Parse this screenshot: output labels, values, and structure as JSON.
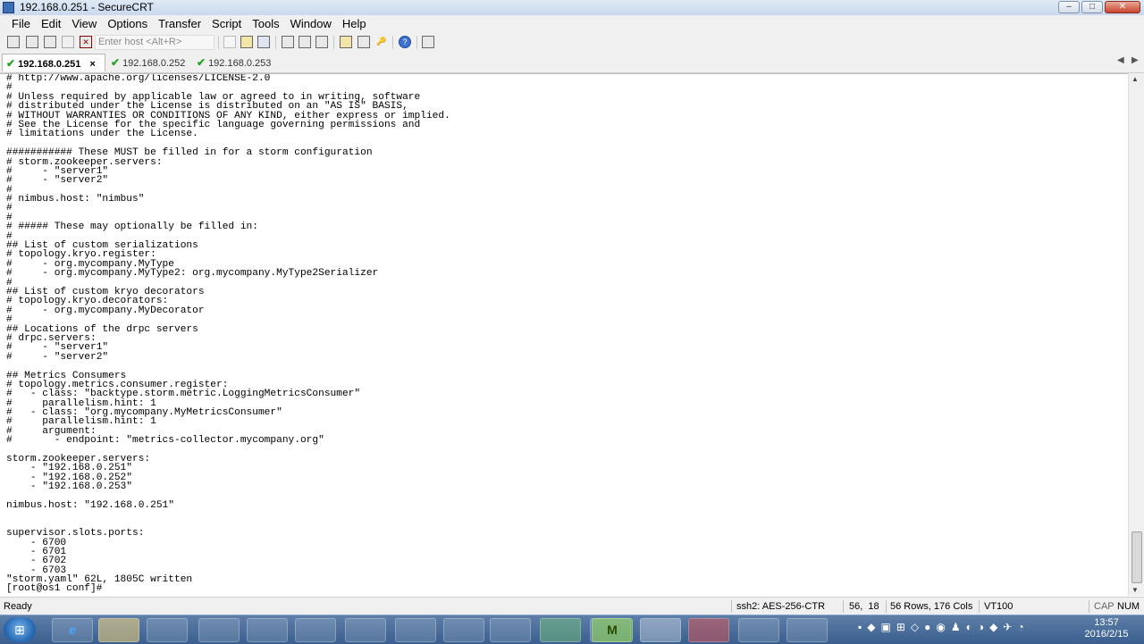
{
  "window": {
    "title": "192.168.0.251 - SecureCRT",
    "buttons": {
      "minimize": "–",
      "maximize": "□",
      "close": "✕"
    }
  },
  "menu": [
    "File",
    "Edit",
    "View",
    "Options",
    "Transfer",
    "Script",
    "Tools",
    "Window",
    "Help"
  ],
  "toolbar": {
    "host_placeholder": "Enter host <Alt+R>"
  },
  "tabs": [
    {
      "label": "192.168.0.251",
      "active": true,
      "close": "×"
    },
    {
      "label": "192.168.0.252",
      "active": false
    },
    {
      "label": "192.168.0.253",
      "active": false
    }
  ],
  "tab_nav": {
    "prev": "◀",
    "next": "▶"
  },
  "terminal": {
    "lines": [
      "# http://www.apache.org/licenses/LICENSE-2.0",
      "#",
      "# Unless required by applicable law or agreed to in writing, software",
      "# distributed under the License is distributed on an \"AS IS\" BASIS,",
      "# WITHOUT WARRANTIES OR CONDITIONS OF ANY KIND, either express or implied.",
      "# See the License for the specific language governing permissions and",
      "# limitations under the License.",
      "",
      "########### These MUST be filled in for a storm configuration",
      "# storm.zookeeper.servers:",
      "#     - \"server1\"",
      "#     - \"server2\"",
      "#",
      "# nimbus.host: \"nimbus\"",
      "#",
      "#",
      "# ##### These may optionally be filled in:",
      "#",
      "## List of custom serializations",
      "# topology.kryo.register:",
      "#     - org.mycompany.MyType",
      "#     - org.mycompany.MyType2: org.mycompany.MyType2Serializer",
      "#",
      "## List of custom kryo decorators",
      "# topology.kryo.decorators:",
      "#     - org.mycompany.MyDecorator",
      "#",
      "## Locations of the drpc servers",
      "# drpc.servers:",
      "#     - \"server1\"",
      "#     - \"server2\"",
      "",
      "## Metrics Consumers",
      "# topology.metrics.consumer.register:",
      "#   - class: \"backtype.storm.metric.LoggingMetricsConsumer\"",
      "#     parallelism.hint: 1",
      "#   - class: \"org.mycompany.MyMetricsConsumer\"",
      "#     parallelism.hint: 1",
      "#     argument:",
      "#       - endpoint: \"metrics-collector.mycompany.org\"",
      "",
      "storm.zookeeper.servers:",
      "    - \"192.168.0.251\"",
      "    - \"192.168.0.252\"",
      "    - \"192.168.0.253\"",
      "",
      "nimbus.host: \"192.168.0.251\"",
      "",
      "",
      "supervisor.slots.ports:",
      "    - 6700",
      "    - 6701",
      "    - 6702",
      "    - 6703",
      "\"storm.yaml\" 62L, 1805C written",
      "[root@os1 conf]# "
    ]
  },
  "status": {
    "ready": "Ready",
    "encryption": "ssh2: AES-256-CTR",
    "cursor": "56,  18",
    "size": "56 Rows, 176 Cols",
    "emulation": "VT100",
    "cap": "CAP",
    "num": "NUM"
  },
  "taskbar": {
    "apps": [
      "e",
      "",
      "",
      "",
      "",
      "",
      "",
      "",
      "",
      "",
      "",
      "",
      "M",
      "",
      "",
      "",
      ""
    ],
    "clock_time": "13:57",
    "clock_date": "2016/2/15"
  }
}
